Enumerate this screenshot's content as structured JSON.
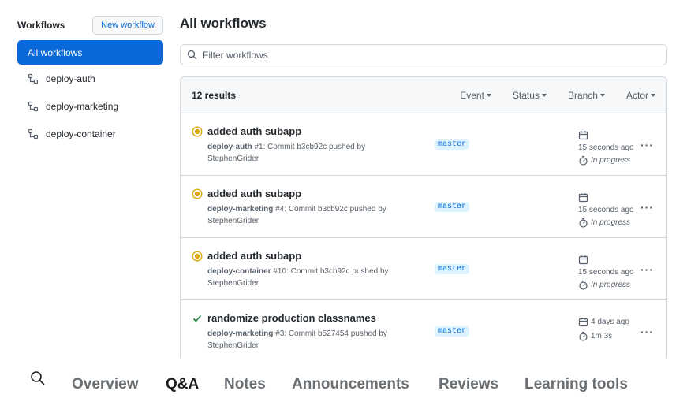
{
  "sidebar": {
    "title": "Workflows",
    "new_button": "New workflow",
    "all_label": "All workflows",
    "items": [
      {
        "label": "deploy-auth",
        "icon": "workflow-icon"
      },
      {
        "label": "deploy-marketing",
        "icon": "workflow-icon"
      },
      {
        "label": "deploy-container",
        "icon": "workflow-icon"
      }
    ]
  },
  "main": {
    "title": "All workflows",
    "filter_placeholder": "Filter workflows",
    "results": "12 results",
    "filters": [
      "Event",
      "Status",
      "Branch",
      "Actor"
    ]
  },
  "runs": [
    {
      "status": "in-progress",
      "title": "added auth subapp",
      "workflow": "deploy-auth",
      "meta_rest": " #1: Commit b3cb92c pushed by",
      "actor": "StephenGrider",
      "branch": "master",
      "time": "15 seconds ago",
      "duration": "In progress"
    },
    {
      "status": "in-progress",
      "title": "added auth subapp",
      "workflow": "deploy-marketing",
      "meta_rest": " #4: Commit b3cb92c pushed by",
      "actor": "StephenGrider",
      "branch": "master",
      "time": "15 seconds ago",
      "duration": "In progress"
    },
    {
      "status": "in-progress",
      "title": "added auth subapp",
      "workflow": "deploy-container",
      "meta_rest": " #10: Commit b3cb92c pushed by",
      "actor": "StephenGrider",
      "branch": "master",
      "time": "15 seconds ago",
      "duration": "In progress"
    },
    {
      "status": "success",
      "title": "randomize production classnames",
      "workflow": "deploy-marketing",
      "meta_rest": " #3: Commit b527454 pushed by",
      "actor": "StephenGrider",
      "branch": "master",
      "time": "4 days ago",
      "duration": "1m 3s"
    }
  ],
  "bottom_nav": {
    "items": [
      "Overview",
      "Q&A",
      "Notes",
      "Announcements",
      "Reviews",
      "Learning tools"
    ],
    "active": "Q&A"
  },
  "colors": {
    "accent": "#0969da",
    "in_progress": "#dbab0a",
    "success": "#1a7f37"
  }
}
